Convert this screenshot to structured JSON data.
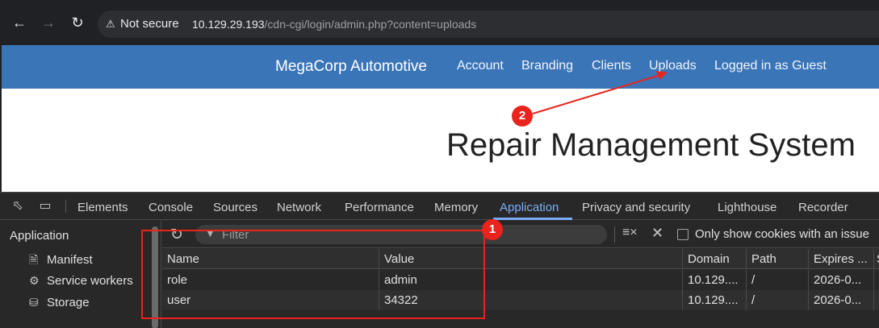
{
  "browser": {
    "security_label": "Not secure",
    "url_host": "10.129.29.193",
    "url_path": "/cdn-cgi/login/admin.php?content=uploads"
  },
  "site": {
    "brand": "MegaCorp Automotive",
    "nav": [
      "Account",
      "Branding",
      "Clients",
      "Uploads",
      "Logged in as Guest"
    ],
    "title": "Repair Management System"
  },
  "devtools": {
    "tabs": [
      "Elements",
      "Console",
      "Sources",
      "Network",
      "Performance",
      "Memory",
      "Application",
      "Privacy and security",
      "Lighthouse",
      "Recorder"
    ],
    "active_tab": "Application",
    "sidebar": {
      "heading": "Application",
      "items": [
        "Manifest",
        "Service workers",
        "Storage"
      ]
    },
    "filter_placeholder": "Filter",
    "only_issue_label": "Only show cookies with an issue",
    "columns": [
      "Name",
      "Value",
      "Domain",
      "Path",
      "Expires ...",
      "S"
    ],
    "rows": [
      {
        "name": "role",
        "value": "admin",
        "domain": "10.129....",
        "path": "/",
        "expires": "2026-0..."
      },
      {
        "name": "user",
        "value": "34322",
        "domain": "10.129....",
        "path": "/",
        "expires": "2026-0..."
      }
    ]
  },
  "annotations": {
    "badge1": "1",
    "badge2": "2",
    "color": "#e8241d"
  },
  "icons": [
    "back-icon",
    "forward-icon",
    "reload-icon",
    "warning-icon",
    "inspect-icon",
    "device-toggle-icon",
    "file-icon",
    "gear-icon",
    "database-icon",
    "refresh-icon",
    "filter-icon",
    "clear-filter-icon",
    "close-icon"
  ]
}
